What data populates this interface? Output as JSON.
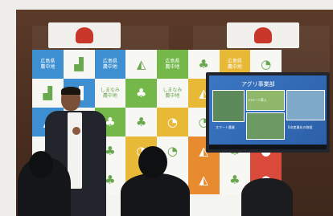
{
  "scene": {
    "backdrop_tiles": [
      {
        "c": "b",
        "t": "広島県\n農中地",
        "i": ""
      },
      {
        "c": "w",
        "t": "",
        "i": "factory-icon"
      },
      {
        "c": "b",
        "t": "広島県\n農中地",
        "i": ""
      },
      {
        "c": "w",
        "t": "",
        "i": "ship-icon"
      },
      {
        "c": "g",
        "t": "広島県\n農中地",
        "i": ""
      },
      {
        "c": "w",
        "t": "",
        "i": "clover-icon"
      },
      {
        "c": "y",
        "t": "広島県\n農中地",
        "i": ""
      },
      {
        "c": "w",
        "t": "",
        "i": "wifi-icon"
      },
      {
        "c": "w",
        "t": "",
        "i": "factory-icon"
      },
      {
        "c": "b",
        "t": "",
        "i": "factory-icon"
      },
      {
        "c": "w",
        "t": "しまなみ\n農中地",
        "i": ""
      },
      {
        "c": "g",
        "t": "",
        "i": "clover-icon"
      },
      {
        "c": "w",
        "t": "しまなみ\n農中地",
        "i": ""
      },
      {
        "c": "y",
        "t": "",
        "i": "ship-icon"
      },
      {
        "c": "w",
        "t": "",
        "i": "clover-icon"
      },
      {
        "c": "o",
        "t": "",
        "i": "wifi-icon"
      },
      {
        "c": "b",
        "t": "",
        "i": "ship-icon"
      },
      {
        "c": "w",
        "t": "",
        "i": "ship-icon"
      },
      {
        "c": "g",
        "t": "",
        "i": "clover-icon"
      },
      {
        "c": "w",
        "t": "",
        "i": "clover-icon"
      },
      {
        "c": "y",
        "t": "",
        "i": "wifi-icon"
      },
      {
        "c": "w",
        "t": "",
        "i": "wifi-icon"
      },
      {
        "c": "o",
        "t": "",
        "i": "ship-icon"
      },
      {
        "c": "w",
        "t": "",
        "i": "clover-icon"
      },
      {
        "c": "w",
        "t": "",
        "i": "clover-icon"
      },
      {
        "c": "g",
        "t": "",
        "i": "clover-icon"
      },
      {
        "c": "w",
        "t": "",
        "i": "clover-icon"
      },
      {
        "c": "y",
        "t": "",
        "i": "wifi-icon"
      },
      {
        "c": "w",
        "t": "",
        "i": "wifi-icon"
      },
      {
        "c": "o",
        "t": "",
        "i": "ship-icon"
      },
      {
        "c": "w",
        "t": "",
        "i": "clover-icon"
      },
      {
        "c": "r",
        "t": "",
        "i": "apple-icon"
      },
      {
        "c": "w",
        "t": "",
        "i": "clover-icon"
      },
      {
        "c": "b",
        "t": "",
        "i": "ship-icon"
      },
      {
        "c": "w",
        "t": "",
        "i": "clover-icon"
      },
      {
        "c": "y",
        "t": "",
        "i": "clover-icon"
      },
      {
        "c": "w",
        "t": "",
        "i": "wifi-icon"
      },
      {
        "c": "o",
        "t": "",
        "i": "ship-icon"
      },
      {
        "c": "w",
        "t": "",
        "i": "clover-icon"
      },
      {
        "c": "r",
        "t": "",
        "i": "apple-icon"
      }
    ],
    "slide": {
      "title": "アグリ事業部",
      "caption_1": "ドローン導入",
      "caption_2": "スマート農業",
      "caption_3": "6次産業化の取組"
    }
  }
}
